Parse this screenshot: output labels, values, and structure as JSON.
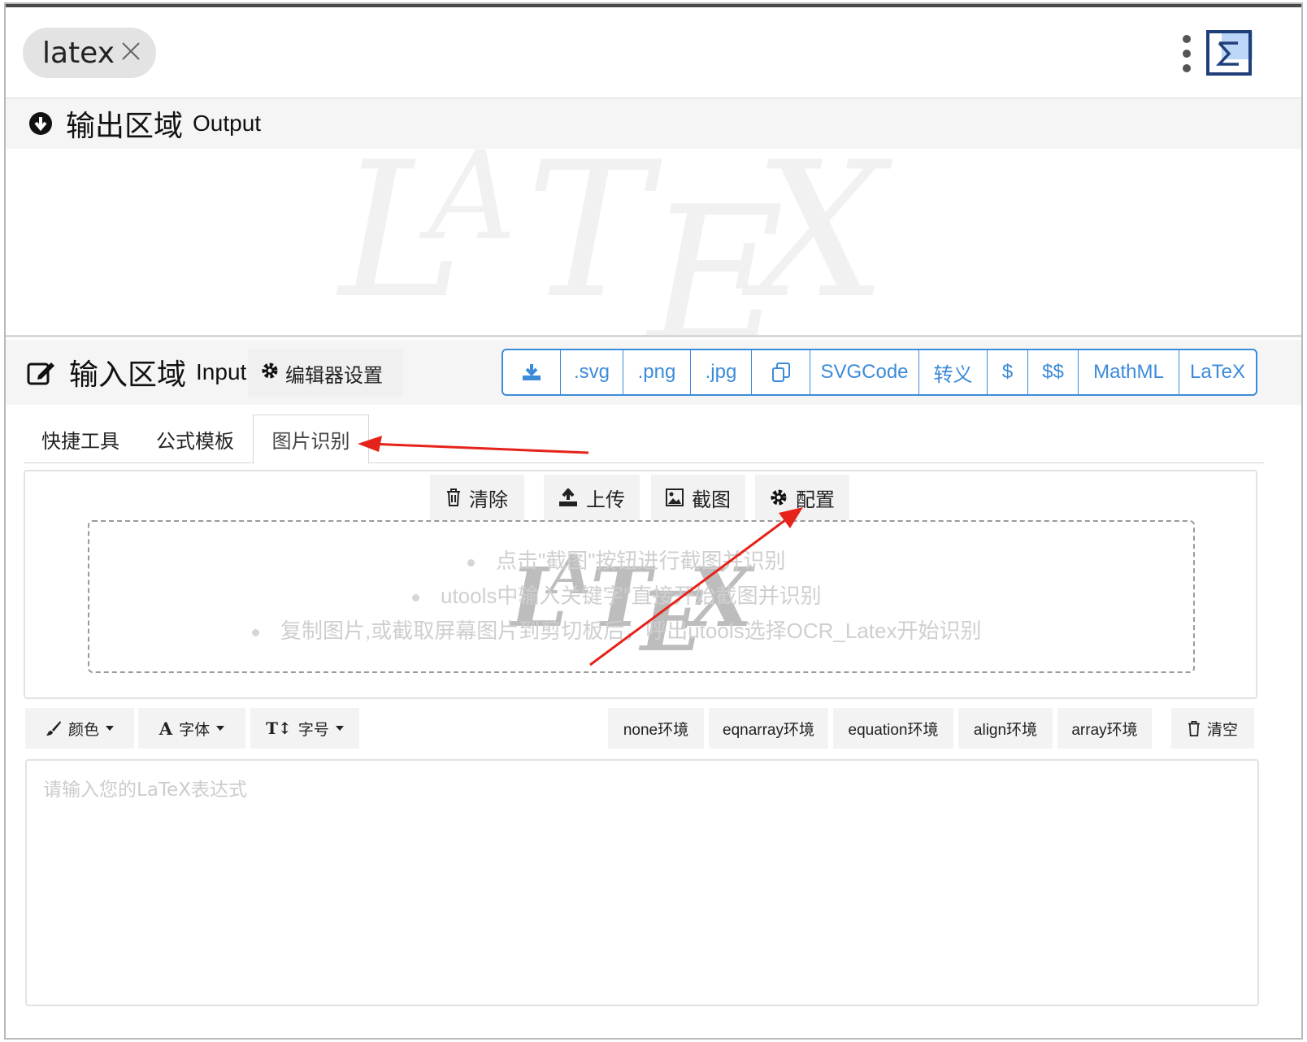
{
  "header": {
    "search_value": "latex"
  },
  "output": {
    "title_cn": "输出区域",
    "title_en": "Output"
  },
  "input": {
    "title_cn": "输入区域",
    "title_en": "Input",
    "editor_settings": "编辑器设置",
    "export_buttons": [
      ".svg",
      ".png",
      ".jpg",
      "SVGCode",
      "转义",
      "$",
      "$$",
      "MathML",
      "LaTeX"
    ]
  },
  "tabs": [
    "快捷工具",
    "公式模板",
    "图片识别"
  ],
  "ocr": {
    "clear": "清除",
    "upload": "上传",
    "screenshot": "截图",
    "config": "配置",
    "hints": [
      "点击\"截图\"按钮进行截图并识别",
      "utools中输入关键字\"直接开始截图并识别",
      "复制图片,或截取屏幕图片到剪切板后，呼出utools选择OCR_Latex开始识别"
    ]
  },
  "toolbar": {
    "color": "颜色",
    "font": "字体",
    "size": "字号",
    "env_none": "none环境",
    "env_eqnarray": "eqnarray环境",
    "env_equation": "equation环境",
    "env_align": "align环境",
    "env_array": "array环境",
    "clear_all": "清空"
  },
  "editor": {
    "placeholder": "请输入您的LaTeX表达式"
  },
  "colors": {
    "accent": "#3c8bd9",
    "annotation": "#e5231b"
  }
}
